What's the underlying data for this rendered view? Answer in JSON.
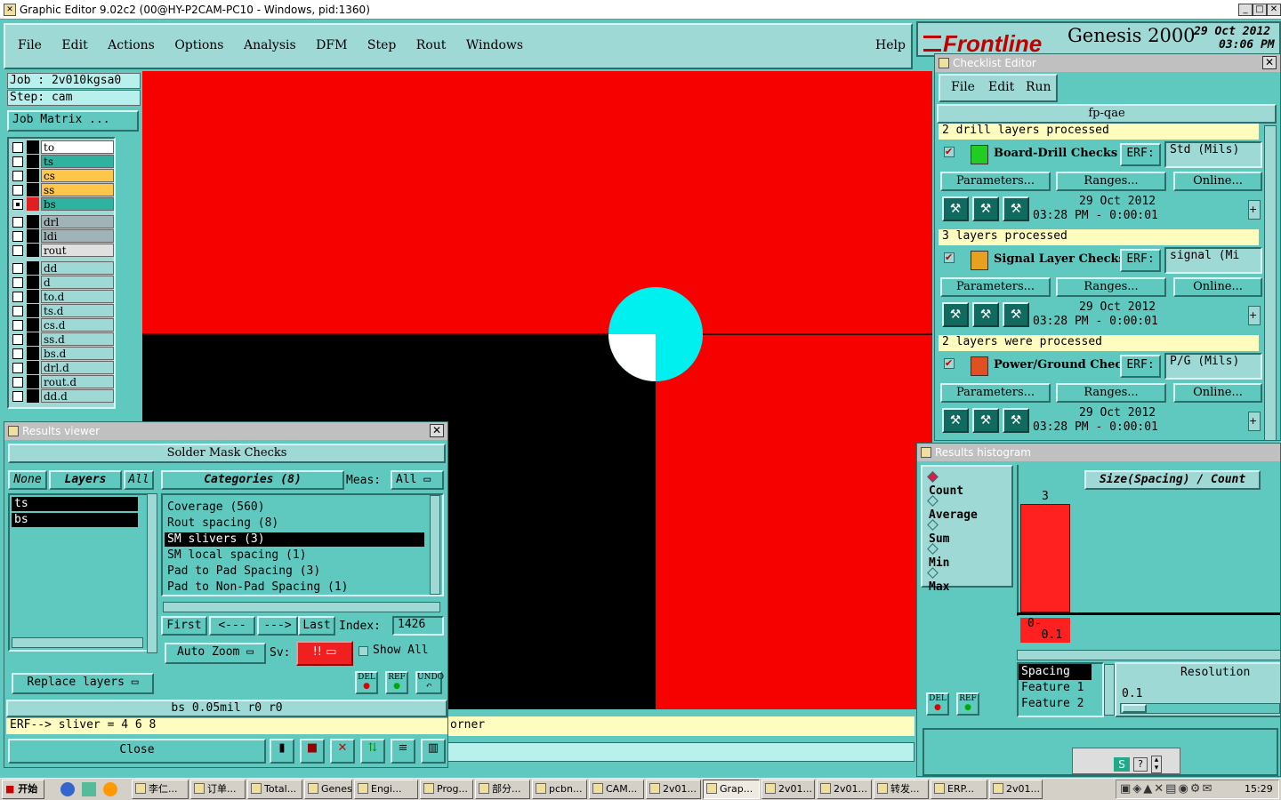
{
  "window": {
    "title": "Graphic Editor 9.02c2 (00@HY-P2CAM-PC10 - Windows, pid:1360)"
  },
  "menu": {
    "items": [
      "File",
      "Edit",
      "Actions",
      "Options",
      "Analysis",
      "DFM",
      "Step",
      "Rout",
      "Windows"
    ],
    "help": "Help"
  },
  "brand": {
    "logo": "Frontline",
    "product": "Genesis 2000",
    "date": "29 Oct 2012",
    "time": "03:06 PM"
  },
  "job": {
    "job_label": "Job : 2v010kgsa0",
    "step_label": "Step: cam",
    "matrix_button": "Job Matrix ..."
  },
  "layers": {
    "group1": [
      "to",
      "ts",
      "cs",
      "ss",
      "bs"
    ],
    "group2": [
      "drl",
      "ldi",
      "rout"
    ],
    "group3": [
      "dd",
      "d",
      "to.d",
      "ts.d",
      "cs.d",
      "ss.d",
      "bs.d",
      "drl.d",
      "rout.d",
      "dd.d"
    ]
  },
  "colors": {
    "canvas_red": "#f60000",
    "canvas_black": "#000000",
    "pad_cyan": "#00f0f0",
    "teal": "#5fc9c0",
    "highlight_yellow": "#fffcc0",
    "hist_bar": "#ff2020"
  },
  "results_viewer": {
    "title": "Results viewer",
    "heading": "Solder Mask Checks",
    "none": "None",
    "layers_tab": "Layers",
    "all_tab": "All",
    "categories_tab": "Categories (8)",
    "meas_label": "Meas:",
    "meas_value": "All",
    "layers": [
      "ts",
      "bs"
    ],
    "categories": [
      "Coverage (560)",
      "Rout spacing (8)",
      "SM slivers (3)",
      "SM local spacing (1)",
      "Pad to Pad Spacing (3)",
      "Pad to Non-Pad Spacing (1)"
    ],
    "selected_category": "SM slivers (3)",
    "first": "First",
    "prev": "<---",
    "next": "--->",
    "last": "Last",
    "index_label": "Index:",
    "index_value": "1426",
    "auto_zoom": "Auto Zoom",
    "sv_label": "Sv:",
    "sv_value": "!!",
    "show_all": "Show All",
    "replace_layers": "Replace layers",
    "status": "bs 0.05mil r0 r0",
    "erf_line": "ERF--> sliver = 4 6 8",
    "close": "Close",
    "del": "DEL",
    "ref": "REF",
    "undo": "UNDO"
  },
  "canvas_status": {
    "text": "orner"
  },
  "checklist": {
    "title": "Checklist Editor",
    "menu": [
      "File",
      "Edit",
      "Run"
    ],
    "name": "fp-qae",
    "blocks": [
      {
        "header": "2 drill layers processed",
        "name": "Board-Drill Checks",
        "erf": "ERF:",
        "erf_value": "Std (Mils)",
        "params": "Parameters...",
        "ranges": "Ranges...",
        "online": "Online...",
        "date": "29 Oct 2012",
        "time": "03:28 PM - 0:00:01"
      },
      {
        "header": "3 layers processed",
        "name": "Signal Layer Checks",
        "erf": "ERF:",
        "erf_value": "signal (Mi",
        "params": "Parameters...",
        "ranges": "Ranges...",
        "online": "Online...",
        "date": "29 Oct 2012",
        "time": "03:28 PM - 0:00:01"
      },
      {
        "header": "2 layers were processed",
        "name": "Power/Ground Checks",
        "erf": "ERF:",
        "erf_value": "P/G (Mils)",
        "params": "Parameters...",
        "ranges": "Ranges...",
        "online": "Online...",
        "date": "29 Oct 2012",
        "time": "03:28 PM - 0:00:01"
      }
    ]
  },
  "histogram": {
    "title": "Results histogram",
    "options": [
      "Count",
      "Average",
      "Sum",
      "Min",
      "Max"
    ],
    "selected": "Count",
    "axis_title": "Size(Spacing) / Count",
    "bar_count": "3",
    "bar_label_1": "0-",
    "bar_label_2": "0.1",
    "list": [
      "Spacing",
      "Feature 1",
      "Feature 2"
    ],
    "resolution_label": "Resolution",
    "resolution_value": "0.1",
    "del": "DEL",
    "ref": "REF"
  },
  "taskbar": {
    "start": "开始",
    "buttons": [
      "李仁...",
      "订单...",
      "Total...",
      "Genesis",
      "Engi...",
      "Prog...",
      "部分...",
      "pcbn...",
      "CAM...",
      "2v01...",
      "Grap...",
      "2v01...",
      "2v01...",
      "转发...",
      "ERP...",
      "2v01..."
    ],
    "clock": "15:29"
  }
}
